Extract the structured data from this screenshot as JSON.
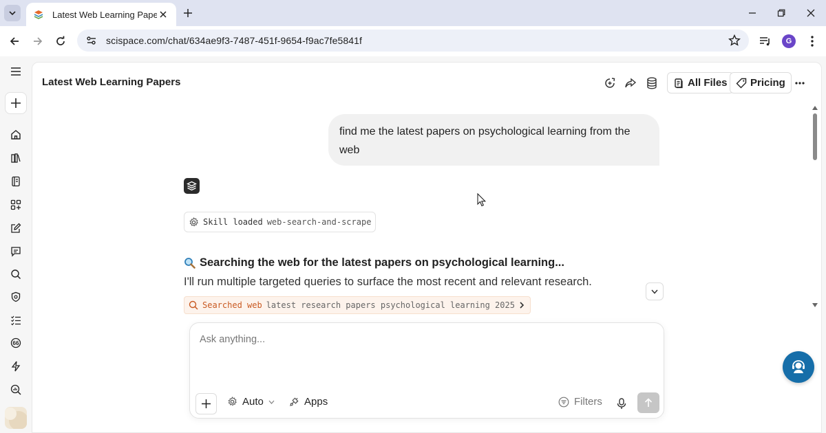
{
  "browser": {
    "tab_title": "Latest Web Learning Papers",
    "url": "scispace.com/chat/634ae9f3-7487-451f-9654-f9ac7fe5841f",
    "profile_initial": "G"
  },
  "header": {
    "title": "Latest Web Learning Papers",
    "all_files_label": "All Files",
    "pricing_label": "Pricing",
    "more_label": "···"
  },
  "chat": {
    "user_message": "find me the latest papers on psychological  learning from the web",
    "skill": {
      "label": "Skill loaded",
      "name": "web-search-and-scrape"
    },
    "search_heading": "Searching the web for the latest papers on psychological learning...",
    "search_description": "I'll run multiple targeted queries to surface the most recent and relevant research.",
    "searched": {
      "label": "Searched web",
      "query": "latest research papers psychological learning 2025"
    }
  },
  "composer": {
    "placeholder": "Ask anything...",
    "mode_label": "Auto",
    "apps_label": "Apps",
    "filters_label": "Filters"
  },
  "colors": {
    "support_button": "#166ea9",
    "searched_label": "#c95a22",
    "searched_bg": "#fdf3ec",
    "profile": "#6a45c8"
  },
  "icons": {
    "left_nav": [
      "menu-icon",
      "plus-icon",
      "home-icon",
      "library-icon",
      "notebook-icon",
      "apps-icon",
      "edit-icon",
      "chat-icon",
      "search-icon",
      "shield-icon",
      "list-icon",
      "quote-icon",
      "bolt-icon",
      "zoom-icon"
    ]
  }
}
